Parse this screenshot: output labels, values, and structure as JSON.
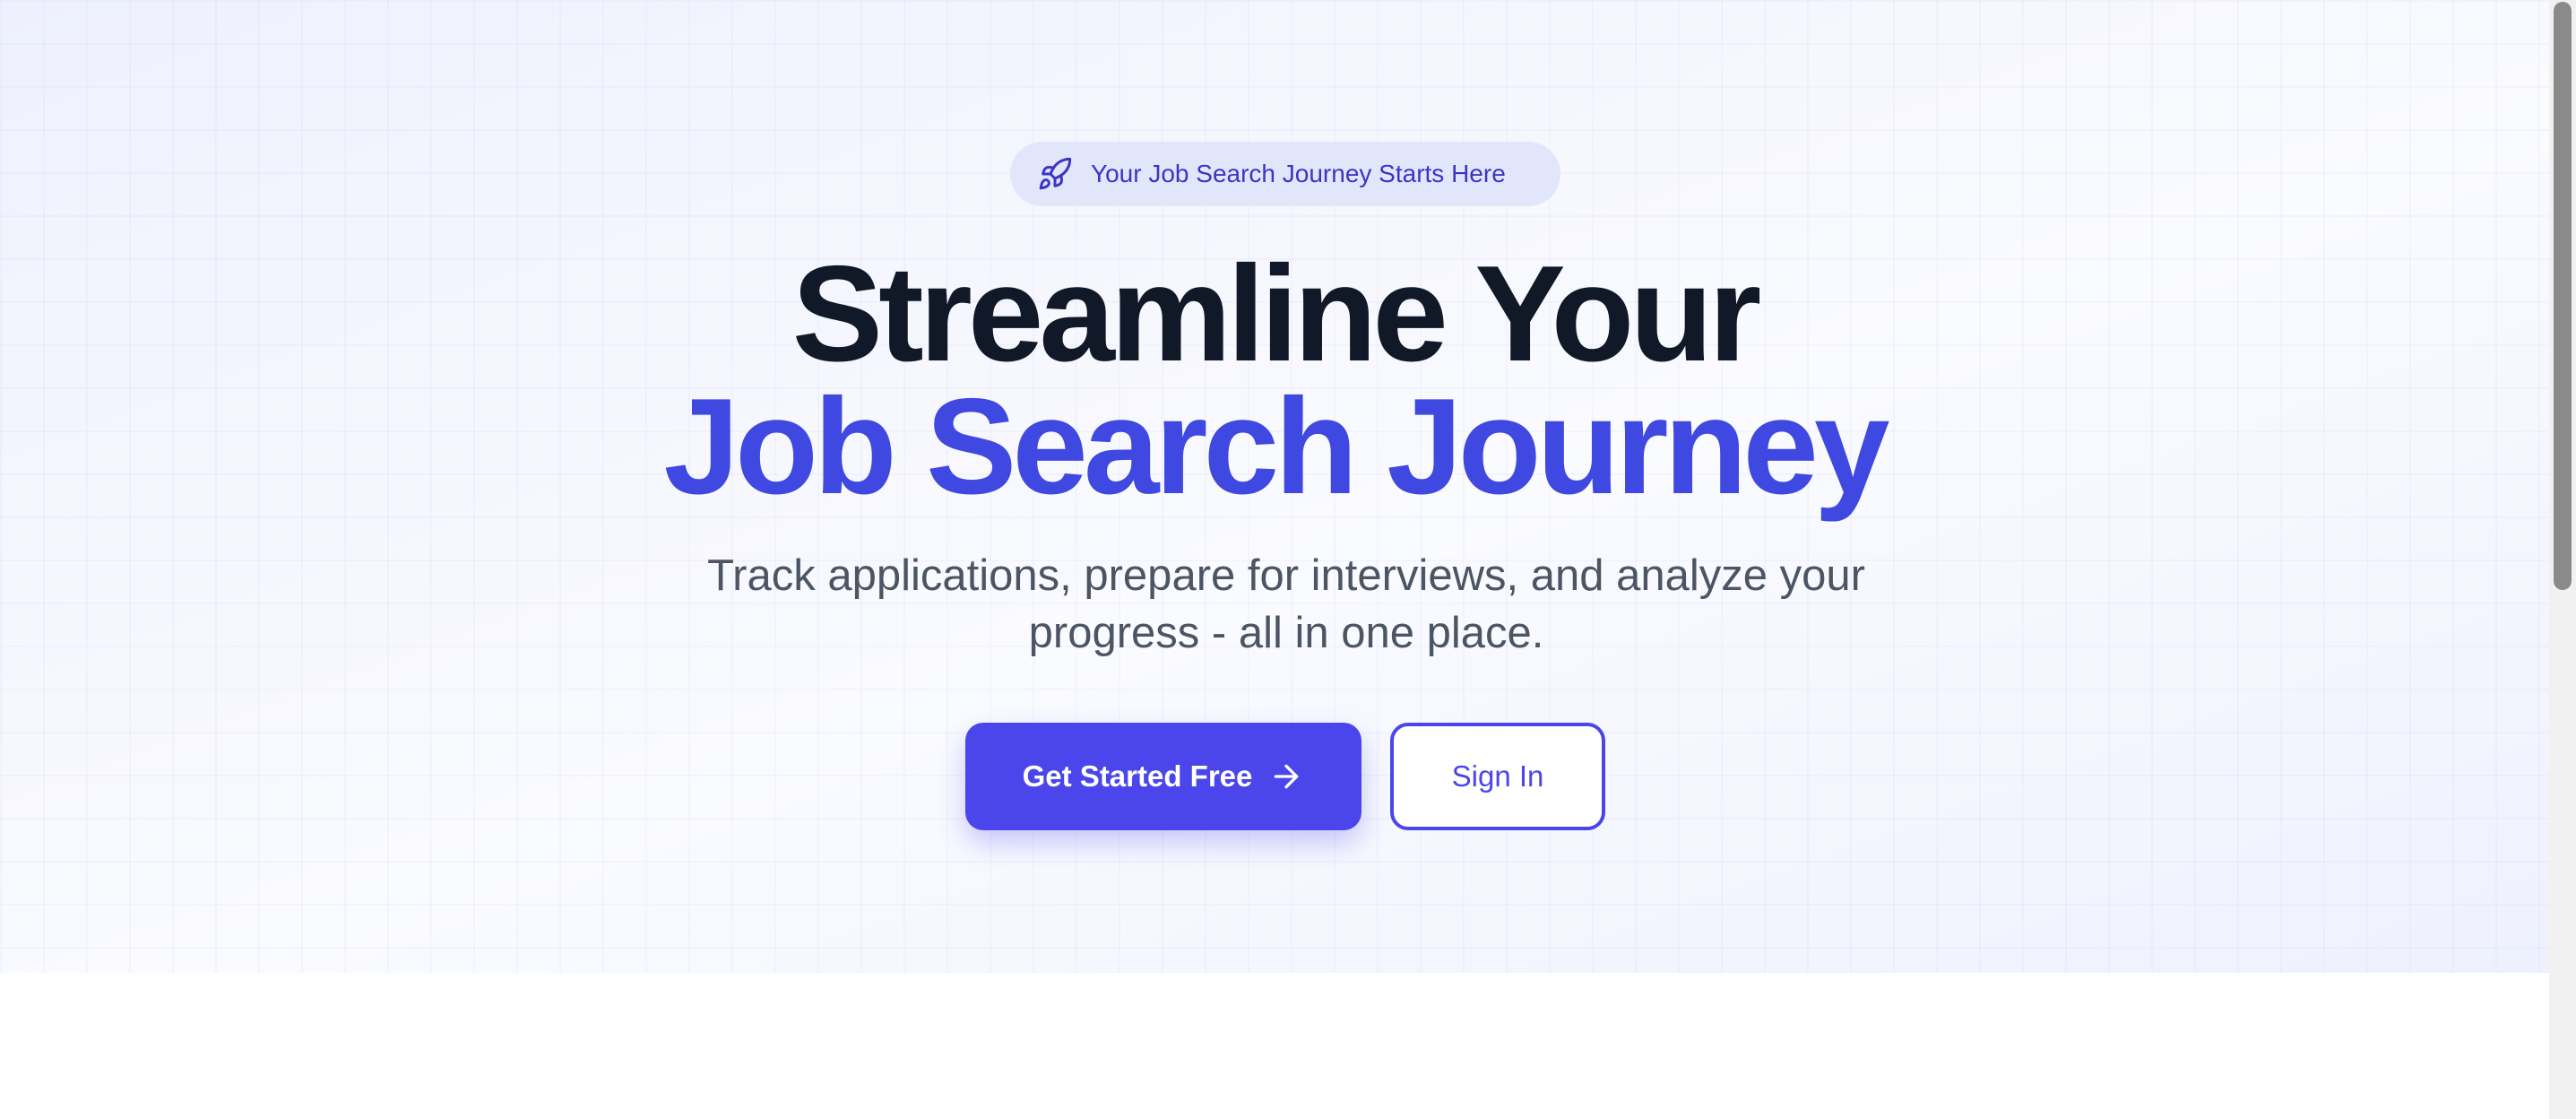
{
  "hero": {
    "badge": {
      "icon": "rocket-icon",
      "text": "Your Job Search Journey Starts Here"
    },
    "headline_line1": "Streamline Your",
    "headline_line2": "Job Search Journey",
    "subtitle": "Track applications, prepare for interviews, and analyze your progress - all in one place.",
    "primary_button": {
      "label": "Get Started Free",
      "icon": "arrow-right-icon"
    },
    "secondary_button": {
      "label": "Sign In"
    }
  },
  "colors": {
    "accent": "#4a46eb",
    "headline_dark": "#111827",
    "headline_accent": "#3f48e0",
    "badge_bg": "#e2e6fb",
    "badge_text": "#3b35c5",
    "subtitle_text": "#4b5563"
  }
}
